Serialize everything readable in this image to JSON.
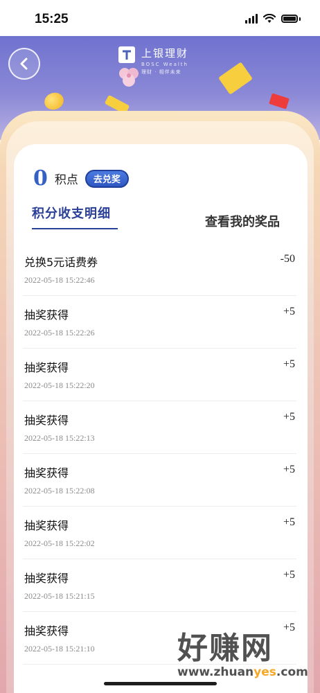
{
  "status_bar": {
    "time": "15:25"
  },
  "banner": {
    "logo_name": "上银理财",
    "logo_en": "BOSC Wealth",
    "logo_slogan": "理财 · 相伴未来"
  },
  "points": {
    "value": "0",
    "unit": "积点",
    "redeem_label": "去兑奖"
  },
  "tabs": {
    "active": "积分收支明细",
    "other": "查看我的奖品"
  },
  "records": [
    {
      "title": "兑换5元话费券",
      "time": "2022-05-18 15:22:46",
      "amount": "-50"
    },
    {
      "title": "抽奖获得",
      "time": "2022-05-18 15:22:26",
      "amount": "+5"
    },
    {
      "title": "抽奖获得",
      "time": "2022-05-18 15:22:20",
      "amount": "+5"
    },
    {
      "title": "抽奖获得",
      "time": "2022-05-18 15:22:13",
      "amount": "+5"
    },
    {
      "title": "抽奖获得",
      "time": "2022-05-18 15:22:08",
      "amount": "+5"
    },
    {
      "title": "抽奖获得",
      "time": "2022-05-18 15:22:02",
      "amount": "+5"
    },
    {
      "title": "抽奖获得",
      "time": "2022-05-18 15:21:15",
      "amount": "+5"
    },
    {
      "title": "抽奖获得",
      "time": "2022-05-18 15:21:10",
      "amount": "+5"
    }
  ],
  "watermark": {
    "cn": "好赚网",
    "url_a": "www.zhuan",
    "url_b": "yes",
    "url_c": ".com"
  },
  "colors": {
    "accent": "#3560c4",
    "banner": "#7b7dd3",
    "frame": "#f5d7b6"
  }
}
